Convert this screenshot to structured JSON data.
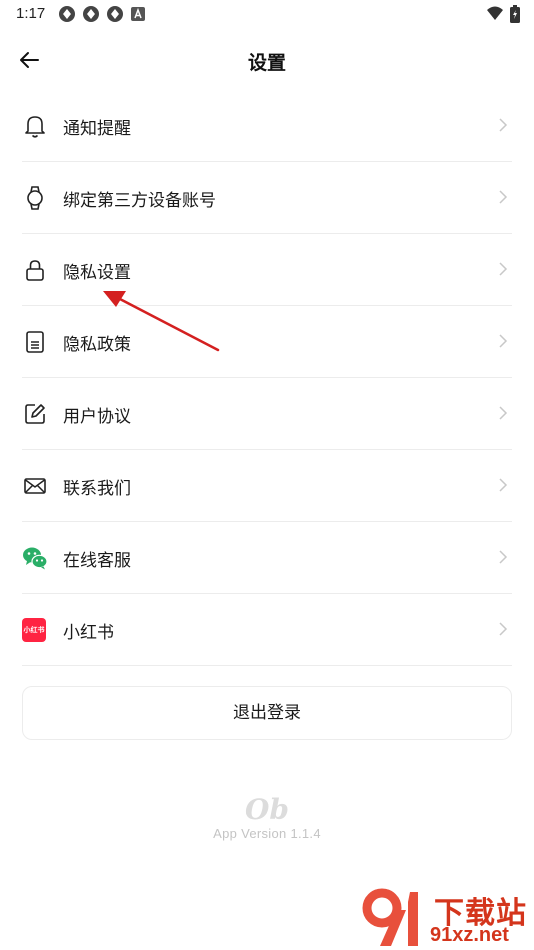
{
  "status_bar": {
    "time": "1:17"
  },
  "header": {
    "title": "设置"
  },
  "menu": [
    {
      "label": "通知提醒",
      "icon": "bell-icon"
    },
    {
      "label": "绑定第三方设备账号",
      "icon": "smartwatch-icon"
    },
    {
      "label": "隐私设置",
      "icon": "lock-icon"
    },
    {
      "label": "隐私政策",
      "icon": "document-icon"
    },
    {
      "label": "用户协议",
      "icon": "edit-icon"
    },
    {
      "label": "联系我们",
      "icon": "mail-icon"
    },
    {
      "label": "在线客服",
      "icon": "wechat-icon"
    },
    {
      "label": "小红书",
      "icon": "xiaohongshu-icon",
      "icon_text": "小红书"
    }
  ],
  "logout_label": "退出登录",
  "footer": {
    "logo": "Ob",
    "version": "App Version 1.1.4"
  },
  "watermark": {
    "main": "下载站",
    "sub": "91xz.net"
  },
  "colors": {
    "accent_red": "#d4351c",
    "wechat_green": "#2aae67",
    "xhs_red": "#ff2442"
  }
}
